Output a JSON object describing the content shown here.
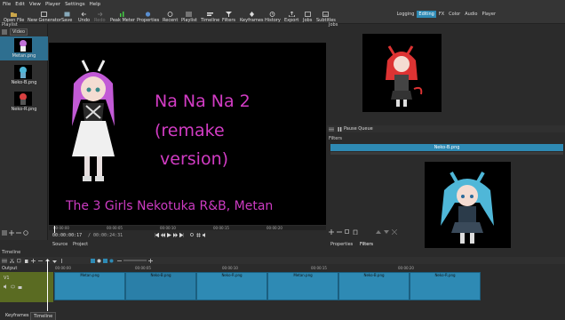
{
  "menu": [
    "File",
    "Edit",
    "View",
    "Player",
    "Settings",
    "Help"
  ],
  "toolbar": {
    "open_file": "Open File",
    "open_generator": "New Generator",
    "save": "Save",
    "undo": "Undo",
    "redo": "Redo",
    "peak_meter": "Peak Meter",
    "properties": "Properties",
    "recent": "Recent",
    "playlist": "Playlist",
    "timeline": "Timeline",
    "filters": "Filters",
    "keyframes": "Keyframes",
    "history": "History",
    "export": "Export",
    "jobs": "Jobs",
    "subtitles": "Subtitles"
  },
  "layouts": {
    "logging": "Logging",
    "editing": "Editing",
    "fx": "FX",
    "color": "Color",
    "audio": "Audio",
    "player": "Player"
  },
  "playlist": {
    "title": "Playlist",
    "tab": "Video",
    "items": [
      {
        "name": "Metan.png"
      },
      {
        "name": "Neko-B.png"
      },
      {
        "name": "Neko-R.png"
      }
    ]
  },
  "player": {
    "title_lines": [
      "Na Na Na 2",
      "(remake",
      " version)"
    ],
    "credit": "The 3 Girls Nekotuka R&B, Metan",
    "ruler": [
      "00:00:00",
      "00:00:05",
      "00:00:10",
      "00:00:15",
      "00:00:20"
    ],
    "timecode": "00:00:00:17",
    "duration": "/ 00:00:24:31",
    "tab_source": "Source",
    "tab_project": "Project"
  },
  "jobs": {
    "title": "Jobs",
    "pause_queue": "Pause Queue"
  },
  "filters": {
    "title": "Filters",
    "clip_name": "Neko-B.png",
    "tab_properties": "Properties",
    "tab_filters": "Filters"
  },
  "timeline": {
    "title": "Timeline",
    "output_label": "Output",
    "track_label": "V1",
    "ruler": [
      "00:00:00",
      "00:00:05",
      "00:00:10",
      "00:00:15",
      "00:00:20"
    ],
    "clips": [
      "Metan.png",
      "Neko-B.png",
      "Neko-R.png",
      "Metan.png",
      "Neko-B.png",
      "Neko-R.png"
    ]
  },
  "bottom_tabs": {
    "keyframes": "Keyframes",
    "timeline": "Timeline"
  },
  "colors": {
    "accent": "#2e8ab4",
    "title_magenta": "#d23cc4"
  }
}
